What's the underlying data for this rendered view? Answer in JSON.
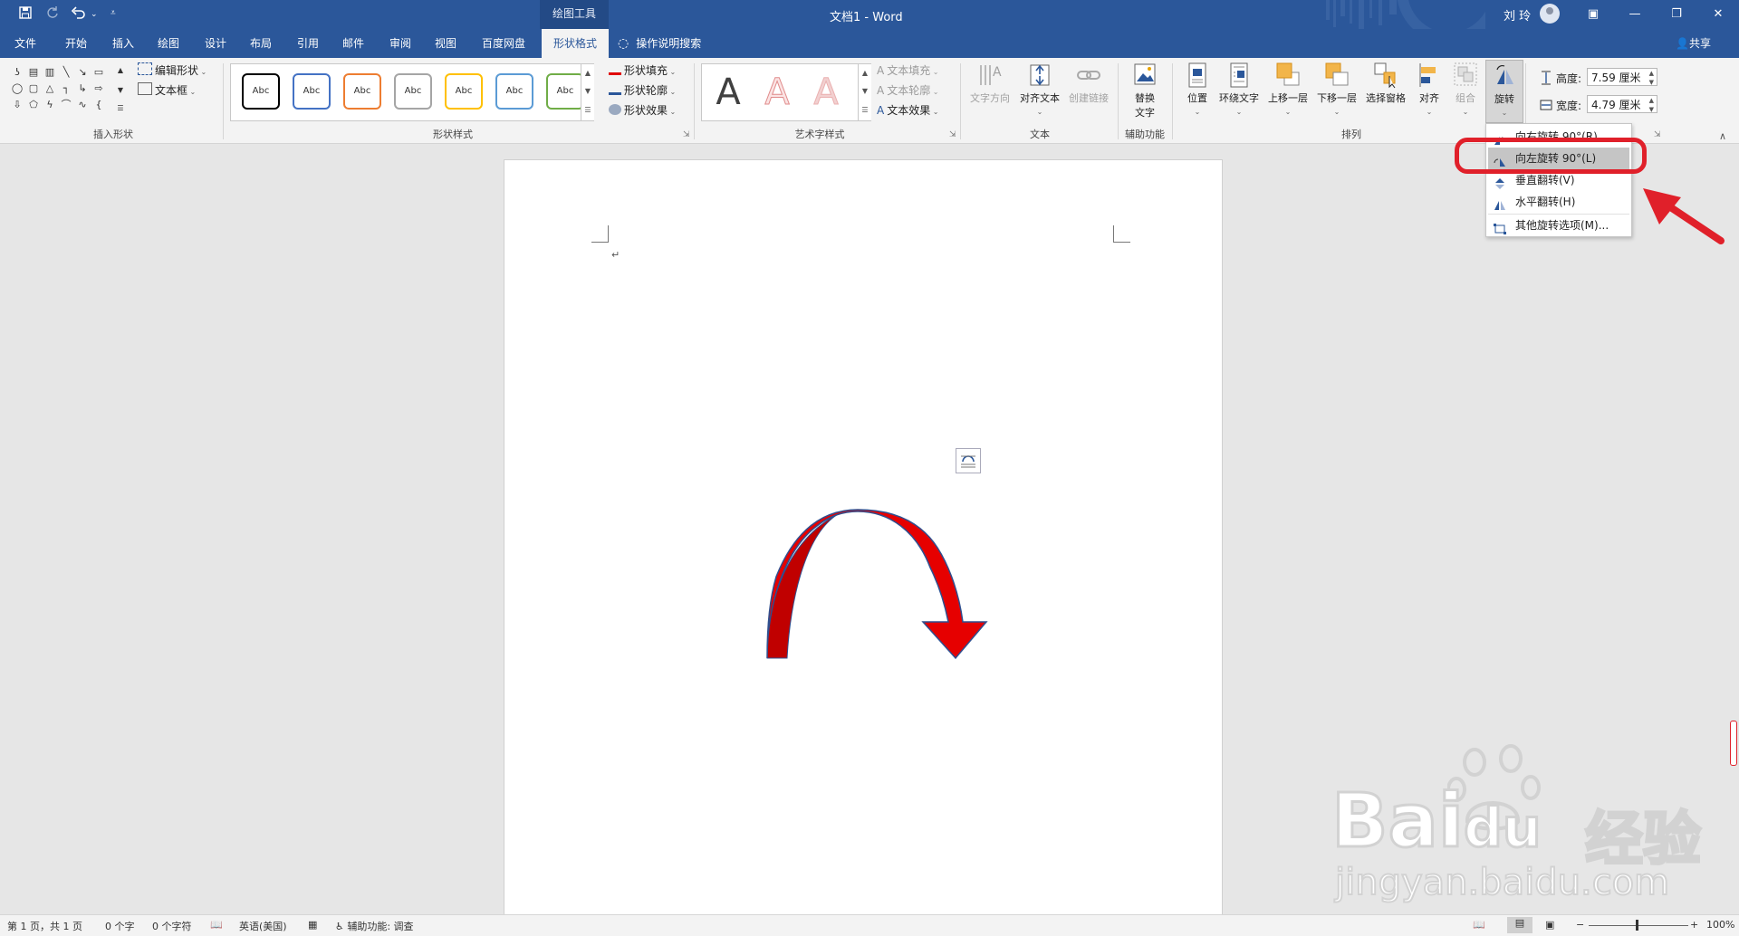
{
  "title_bar": {
    "contextual_group": "绘图工具",
    "document_title": "文档1  -  Word",
    "user_name": "刘 玲",
    "qat_icons": [
      "save-icon",
      "autosave-icon",
      "undo-icon",
      "customize-qat-icon"
    ]
  },
  "tabs": [
    {
      "label": "文件"
    },
    {
      "label": "开始"
    },
    {
      "label": "插入"
    },
    {
      "label": "绘图"
    },
    {
      "label": "设计"
    },
    {
      "label": "布局"
    },
    {
      "label": "引用"
    },
    {
      "label": "邮件"
    },
    {
      "label": "审阅"
    },
    {
      "label": "视图"
    },
    {
      "label": "百度网盘"
    },
    {
      "label": "形状格式",
      "active": true
    }
  ],
  "tell_me": "操作说明搜索",
  "share": "共享",
  "ribbon": {
    "insert_shapes": {
      "group_label": "插入形状",
      "edit_shape": "编辑形状",
      "text_box": "文本框"
    },
    "shape_styles": {
      "group_label": "形状样式",
      "swatch_text": "Abc",
      "swatch_colors": [
        "#000000",
        "#4472c4",
        "#ed7d31",
        "#a5a5a5",
        "#ffc000",
        "#5b9bd5",
        "#70ad47"
      ],
      "shape_fill": "形状填充",
      "shape_outline": "形状轮廓",
      "shape_effects": "形状效果"
    },
    "wordart_styles": {
      "group_label": "艺术字样式",
      "letter": "A",
      "text_fill": "文本填充",
      "text_outline": "文本轮廓",
      "text_effects": "文本效果"
    },
    "text": {
      "group_label": "文本",
      "text_direction": "文字方向",
      "align_text": "对齐文本",
      "create_link": "创建链接"
    },
    "accessibility": {
      "group_label": "辅助功能",
      "alt_text_line1": "替换",
      "alt_text_line2": "文字"
    },
    "arrange": {
      "group_label": "排列",
      "position": "位置",
      "wrap_text": "环绕文字",
      "bring_forward": "上移一层",
      "send_backward": "下移一层",
      "selection_pane": "选择窗格",
      "align": "对齐",
      "group": "组合",
      "rotate": "旋转"
    },
    "size": {
      "height_label": "高度:",
      "height_value": "7.59 厘米",
      "width_label": "宽度:",
      "width_value": "4.79 厘米"
    }
  },
  "rotate_menu": {
    "items": [
      {
        "label": "向右旋转 90°(R)"
      },
      {
        "label": "向左旋转 90°(L)",
        "highlighted": true
      },
      {
        "label": "垂直翻转(V)"
      },
      {
        "label": "水平翻转(H)"
      },
      {
        "label": "其他旋转选项(M)..."
      }
    ],
    "highlight_color": "#e0202a"
  },
  "document": {
    "paragraph_mark": "↵",
    "shape_fill": "#e60000",
    "shape_shadow_fill": "#c00000",
    "shape_outline": "#2f4f8f"
  },
  "status_bar": {
    "page": "第 1 页，共 1 页",
    "words": "0 个字",
    "chars": "0 个字符",
    "language": "英语(美国)",
    "accessibility": "辅助功能: 调查",
    "zoom": "100%"
  },
  "watermark": {
    "brand": "Bai",
    "brand2": "du",
    "cn": "经验",
    "url": "jingyan.baidu.com"
  }
}
